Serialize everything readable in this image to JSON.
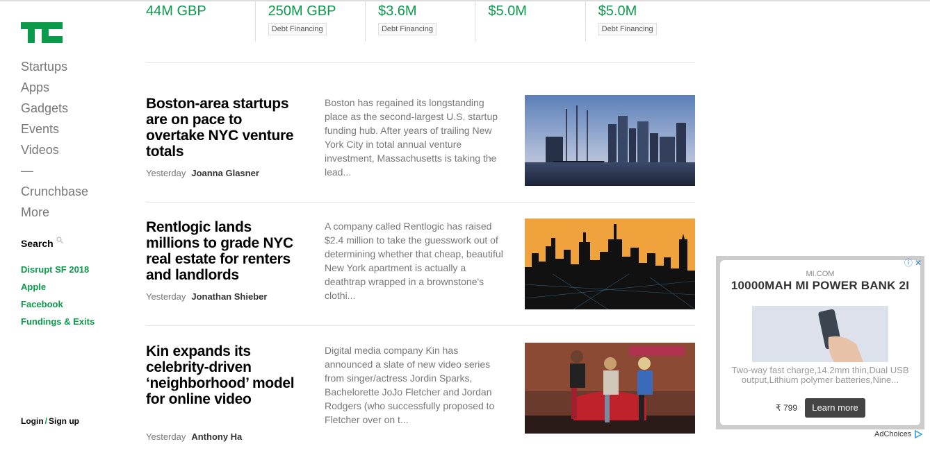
{
  "sidebar": {
    "nav": [
      "Startups",
      "Apps",
      "Gadgets",
      "Events",
      "Videos"
    ],
    "separator": "—",
    "nav2": [
      "Crunchbase",
      "More"
    ],
    "search_label": "Search",
    "tags": [
      "Disrupt SF 2018",
      "Apple",
      "Facebook",
      "Fundings & Exits"
    ],
    "login": "Login",
    "slash": "/",
    "signup": "Sign up"
  },
  "fundings": [
    {
      "amount": "44M GBP",
      "type": ""
    },
    {
      "amount": "250M GBP",
      "type": "Debt Financing"
    },
    {
      "amount": "$3.6M",
      "type": "Debt Financing"
    },
    {
      "amount": "$5.0M",
      "type": ""
    },
    {
      "amount": "$5.0M",
      "type": "Debt Financing"
    }
  ],
  "articles": [
    {
      "headline": "Boston-area startups are on pace to overtake NYC venture totals",
      "time": "Yesterday",
      "author": "Joanna Glasner",
      "excerpt": "Boston has regained its longstanding place as the second-largest U.S. startup funding hub. After years of trailing New York City in total annual venture investment, Massachusetts is taking the lead..."
    },
    {
      "headline": "Rentlogic lands millions to grade NYC real estate for renters and landlords",
      "time": "Yesterday",
      "author": "Jonathan Shieber",
      "excerpt": "A company called Rentlogic has raised $2.4 million to take the guesswork out of determining whether that cheap, beautiful New York apartment is actually a deathtrap wrapped in a brownstone's clothi..."
    },
    {
      "headline": "Kin expands its celebrity-driven ‘neighborhood’ model for online video",
      "time": "Yesterday",
      "author": "Anthony Ha",
      "excerpt": "Digital media company Kin has announced a slate of new video series from singer/actress Jordin Sparks, Bachelorette JoJo Fletcher and Jordan Rodgers (who successfully proposed to Fletcher over on t..."
    }
  ],
  "ad": {
    "domain": "MI.COM",
    "title": "10000MAH MI POWER BANK 2I",
    "desc": "Two-way fast charge,14.2mm thin,Dual USB output,Lithium polymer batteries,Nine...",
    "price": "₹ 799",
    "cta": "Learn more",
    "adchoices": "AdChoices"
  },
  "colors": {
    "accent": "#0a9a4a"
  }
}
